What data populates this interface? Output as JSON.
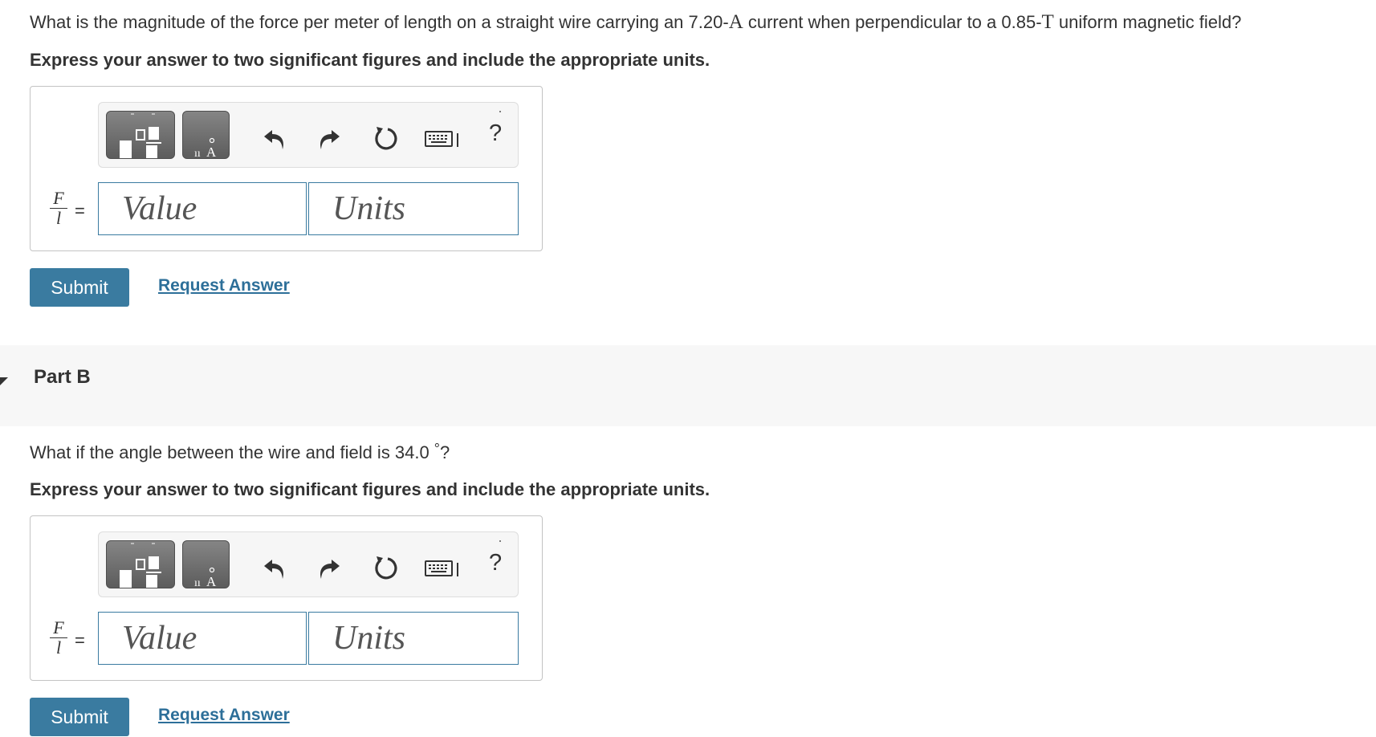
{
  "part_a": {
    "question_prefix": "What is the magnitude of the force per meter of length on a straight wire carrying an 7.20-",
    "current_unit": "A",
    "question_mid": " current when perpendicular to a 0.85-",
    "field_unit": "T",
    "question_suffix": " uniform magnetic field?",
    "instructions": "Express your answer to two significant figures and include the appropriate units.",
    "fraction_num": "F",
    "fraction_den": "l",
    "equals": "=",
    "value_placeholder": "Value",
    "units_placeholder": "Units",
    "submit_label": "Submit",
    "request_answer_label": "Request Answer"
  },
  "part_b": {
    "title": "Part B",
    "question_prefix": "What if the angle between the wire and field is 34.0",
    "degree_symbol": "°",
    "question_suffix": "?",
    "instructions": "Express your answer to two significant figures and include the appropriate units.",
    "fraction_num": "F",
    "fraction_den": "l",
    "equals": "=",
    "value_placeholder": "Value",
    "units_placeholder": "Units",
    "submit_label": "Submit",
    "request_answer_label": "Request Answer"
  },
  "toolbar": {
    "help_label": "?",
    "icons": [
      "templates-icon",
      "units-symbols-icon",
      "undo-icon",
      "redo-icon",
      "reset-icon",
      "keyboard-icon",
      "help-icon"
    ]
  },
  "colors": {
    "accent": "#3a7ba0",
    "link": "#2d6f99",
    "text": "#333333",
    "part_header_bg": "#f7f7f7"
  }
}
